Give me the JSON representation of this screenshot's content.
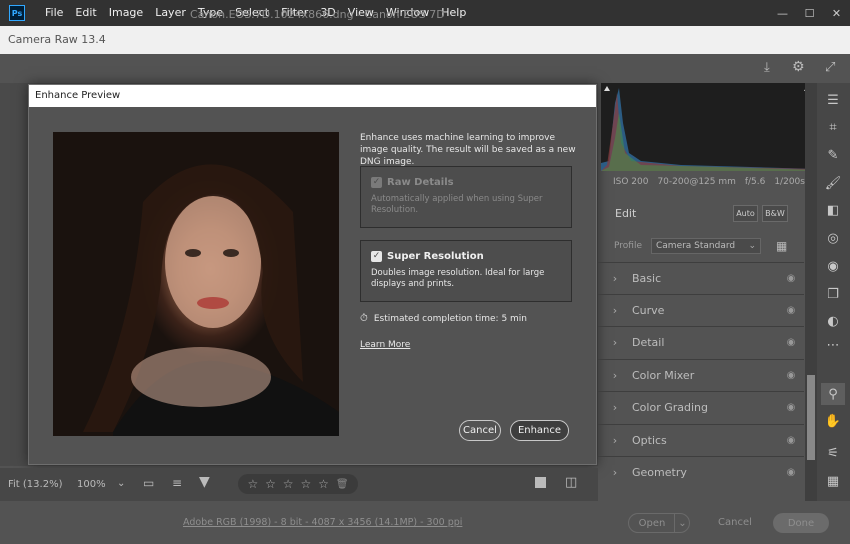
{
  "menu": [
    "File",
    "Edit",
    "Image",
    "Layer",
    "Type",
    "Select",
    "Filter",
    "3D",
    "View",
    "Window",
    "Help"
  ],
  "app_logo": "Ps",
  "window_controls": [
    "—",
    "☐",
    "✕"
  ],
  "title_bar": "Camera Raw 13.4",
  "file_title": "Canon.EOS.7D.1024x866.dng  -  Canon EOS 7D",
  "dialog": {
    "title": "Enhance Preview",
    "description": "Enhance uses machine learning to improve image quality. The result will be saved as a new DNG image.",
    "raw_details": {
      "label": "Raw Details",
      "checked": true,
      "disabled": true,
      "desc": "Automatically applied when using Super Resolution."
    },
    "super_resolution": {
      "label": "Super Resolution",
      "checked": true,
      "desc": "Doubles image resolution. Ideal for large displays and prints."
    },
    "estimated": "Estimated completion time: 5 min",
    "learn_more": "Learn More",
    "cancel": "Cancel",
    "enhance": "Enhance"
  },
  "meta": {
    "iso": "ISO 200",
    "lens": "70-200@125 mm",
    "aperture": "f/5.6",
    "shutter": "1/200s"
  },
  "edit": {
    "label": "Edit",
    "auto": "Auto",
    "bw": "B&W",
    "profile_label": "Profile",
    "profile_value": "Camera Standard"
  },
  "panels": [
    "Basic",
    "Curve",
    "Detail",
    "Color Mixer",
    "Color Grading",
    "Optics",
    "Geometry"
  ],
  "bottom": {
    "fit": "Fit (13.2%)",
    "zoom": "100%",
    "stars": [
      "☆",
      "☆",
      "☆",
      "☆",
      "☆"
    ]
  },
  "status": {
    "workflow": "Adobe RGB (1998) - 8 bit - 4087 x 3456 (14.1MP) - 300 ppi",
    "open": "Open",
    "cancel": "Cancel",
    "done": "Done"
  },
  "colors": {
    "accent": "#31a8ff",
    "dialog_bg": "#535353",
    "panel_bg": "#535353"
  }
}
